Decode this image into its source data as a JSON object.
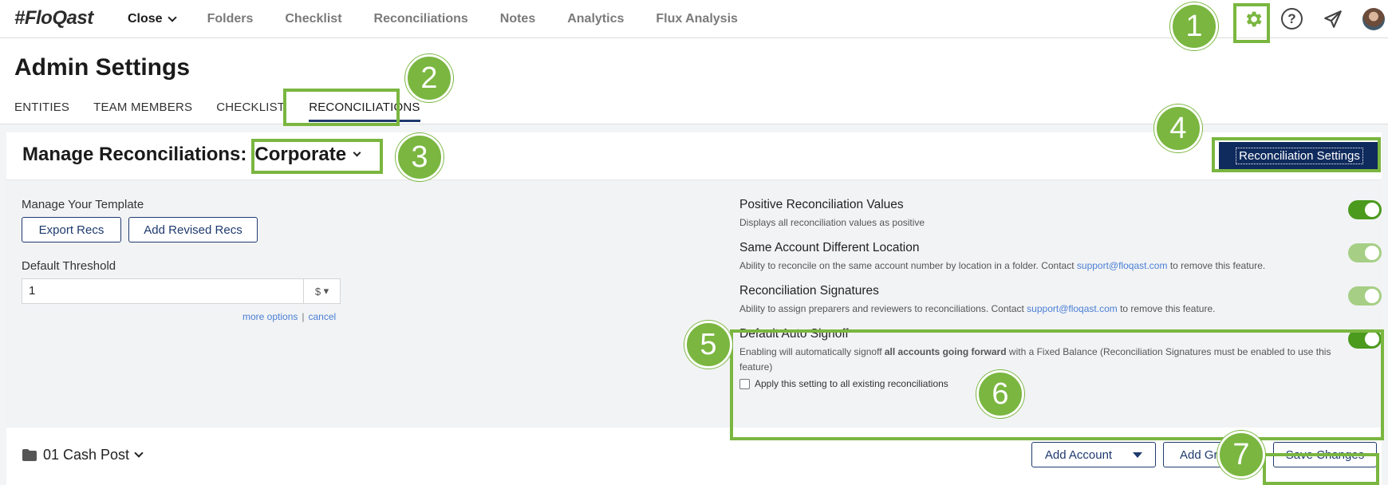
{
  "topbar": {
    "logo": "#FloQast",
    "nav": [
      {
        "label": "Close",
        "active": true
      },
      {
        "label": "Folders"
      },
      {
        "label": "Checklist"
      },
      {
        "label": "Reconciliations"
      },
      {
        "label": "Notes"
      },
      {
        "label": "Analytics"
      },
      {
        "label": "Flux Analysis"
      }
    ],
    "icons": [
      "gear-icon",
      "help-icon",
      "send-icon",
      "avatar"
    ],
    "help_glyph": "?"
  },
  "header": {
    "title": "Admin Settings",
    "tabs": [
      "ENTITIES",
      "TEAM MEMBERS",
      "CHECKLIST",
      "RECONCILIATIONS"
    ],
    "active_tab": "RECONCILIATIONS"
  },
  "panel": {
    "title": "Manage Reconciliations:",
    "entity": "Corporate",
    "settings_button": "Reconciliation Settings",
    "template_label": "Manage Your Template",
    "export_button": "Export Recs",
    "revised_button": "Add Revised Recs",
    "threshold_label": "Default Threshold",
    "threshold_value": "1",
    "currency": "$",
    "more_options": "more options",
    "separator": "|",
    "cancel": "cancel",
    "settings": [
      {
        "title": "Positive Reconciliation Values",
        "desc": "Displays all reconciliation values as positive",
        "on": true
      },
      {
        "title": "Same Account Different Location",
        "desc_pre": "Ability to reconcile on the same account number by location in a folder. Contact ",
        "link": "support@floqast.com",
        "desc_post": " to remove this feature.",
        "on": true,
        "disabled": true
      },
      {
        "title": "Reconciliation Signatures",
        "desc_pre": "Ability to assign preparers and reviewers to reconciliations. Contact ",
        "link": "support@floqast.com",
        "desc_post": " to remove this feature.",
        "on": true,
        "disabled": true
      },
      {
        "title": "Default Auto Signoff",
        "desc_pre": "Enabling will automatically signoff ",
        "desc_bold": "all accounts going forward",
        "desc_post": " with a Fixed Balance (Reconciliation Signatures must be enabled to use this feature)",
        "checkbox": "Apply this setting to all existing reconciliations",
        "on": true
      }
    ]
  },
  "bottom": {
    "folder": "01 Cash Post",
    "add_account": "Add Account",
    "add_group": "Add Gro",
    "save": "Save Changes"
  },
  "annotations": [
    "1",
    "2",
    "3",
    "4",
    "5",
    "6",
    "7"
  ],
  "colors": {
    "accent": "#7ab640",
    "navy": "#0f2a5c",
    "toggle_on": "#4b9a1e",
    "link": "#4a7fd4"
  }
}
